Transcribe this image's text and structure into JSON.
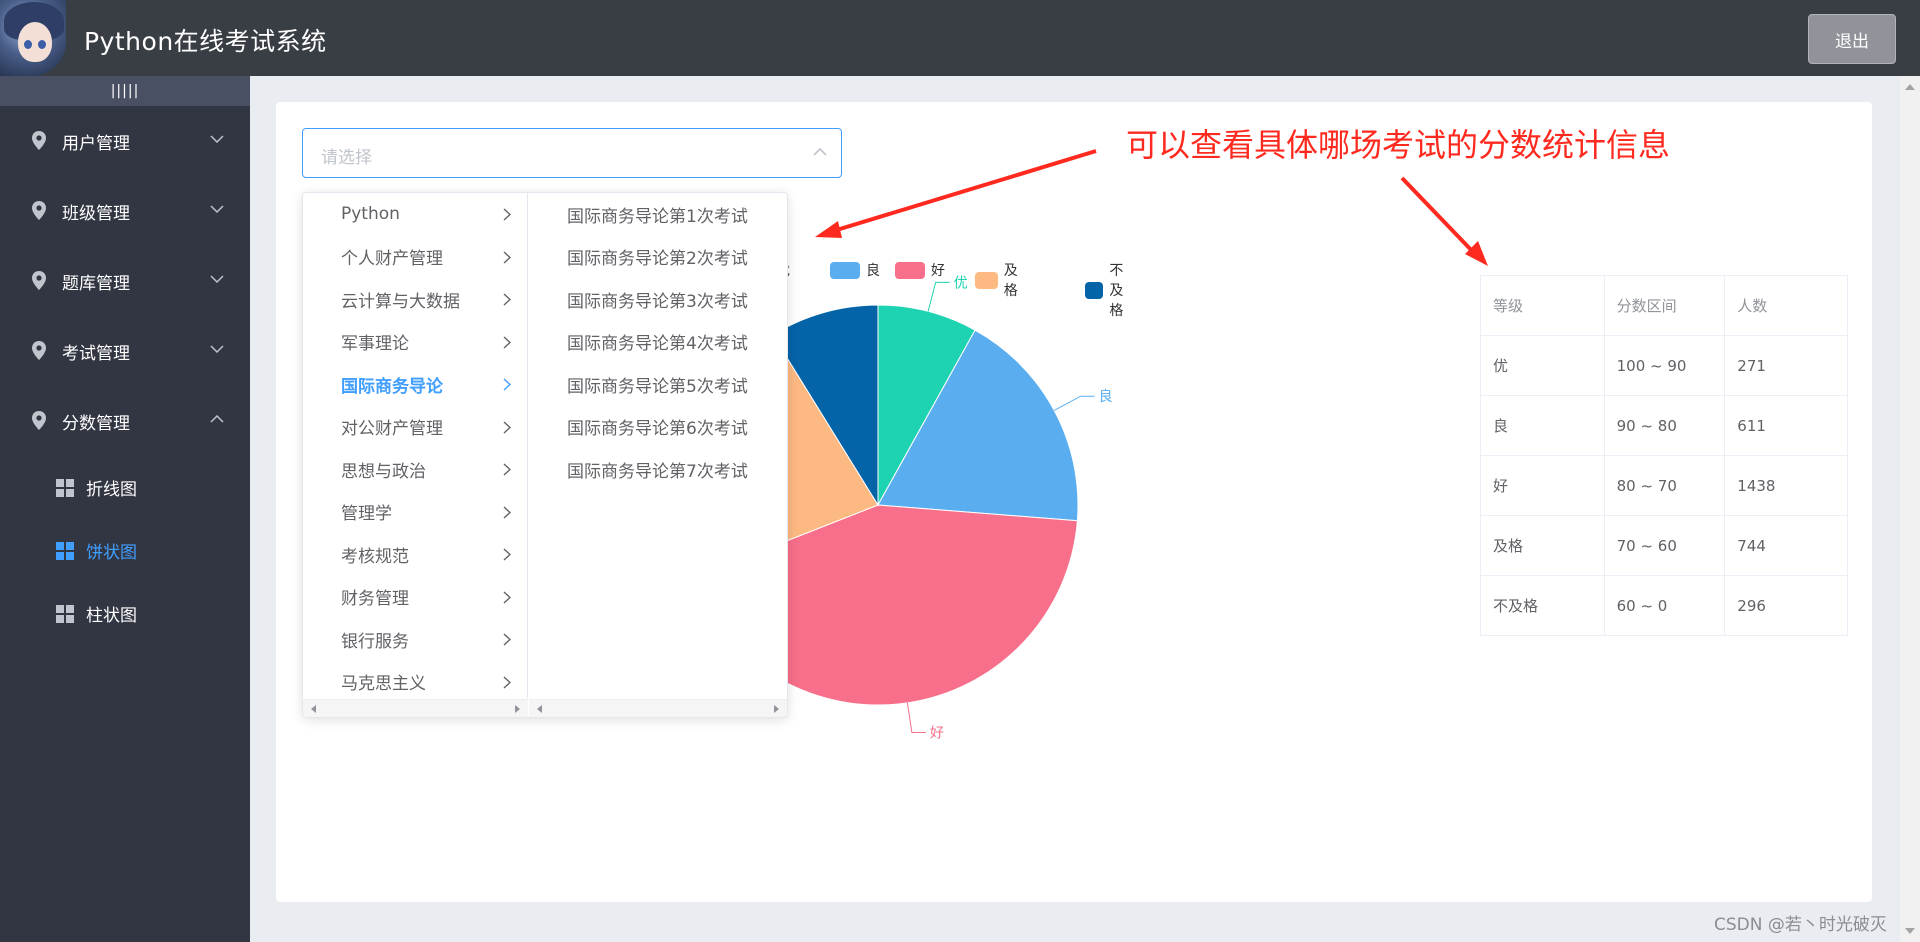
{
  "header": {
    "title": "Python在线考试系统",
    "logout_label": "退出"
  },
  "sidebar": {
    "collapse_label": "|||||",
    "menus": [
      {
        "label": "用户管理",
        "expanded": false
      },
      {
        "label": "班级管理",
        "expanded": false
      },
      {
        "label": "题库管理",
        "expanded": false
      },
      {
        "label": "考试管理",
        "expanded": false
      },
      {
        "label": "分数管理",
        "expanded": true
      }
    ],
    "submenu": [
      {
        "label": "折线图",
        "active": false
      },
      {
        "label": "饼状图",
        "active": true
      },
      {
        "label": "柱状图",
        "active": false
      }
    ]
  },
  "select": {
    "placeholder": "请选择"
  },
  "cascader": {
    "courses": [
      "Python",
      "个人财产管理",
      "云计算与大数据",
      "军事理论",
      "国际商务导论",
      "对公财产管理",
      "思想与政治",
      "管理学",
      "考核规范",
      "财务管理",
      "银行服务",
      "马克思主义"
    ],
    "active_course": "国际商务导论",
    "exams": [
      "国际商务导论第1次考试",
      "国际商务导论第2次考试",
      "国际商务导论第3次考试",
      "国际商务导论第4次考试",
      "国际商务导论第5次考试",
      "国际商务导论第6次考试",
      "国际商务导论第7次考试"
    ]
  },
  "annotation": {
    "text": "可以查看具体哪场考试的分数统计信息",
    "color": "#ff2a1f"
  },
  "chart_data": {
    "type": "pie",
    "series": [
      {
        "name": "优",
        "value": 271,
        "color": "#1ed3b1"
      },
      {
        "name": "良",
        "value": 611,
        "color": "#5aaef0"
      },
      {
        "name": "好",
        "value": 1438,
        "color": "#f76f8a"
      },
      {
        "name": "及格",
        "value": 744,
        "color": "#fdb982"
      },
      {
        "name": "不及格",
        "value": 296,
        "color": "#0563a8"
      }
    ],
    "legend": [
      "优",
      "良",
      "好",
      "及格",
      "不及格"
    ],
    "legend_position": "top",
    "visible_labels": [
      "优",
      "良",
      "好"
    ]
  },
  "stats_table": {
    "headers": [
      "等级",
      "分数区间",
      "人数"
    ],
    "rows": [
      [
        "优",
        "100 ~ 90",
        "271"
      ],
      [
        "良",
        "90 ~ 80",
        "611"
      ],
      [
        "好",
        "80 ~ 70",
        "1438"
      ],
      [
        "及格",
        "70 ~ 60",
        "744"
      ],
      [
        "不及格",
        "60 ~ 0",
        "296"
      ]
    ]
  },
  "watermark": "CSDN @若丶时光破灭"
}
